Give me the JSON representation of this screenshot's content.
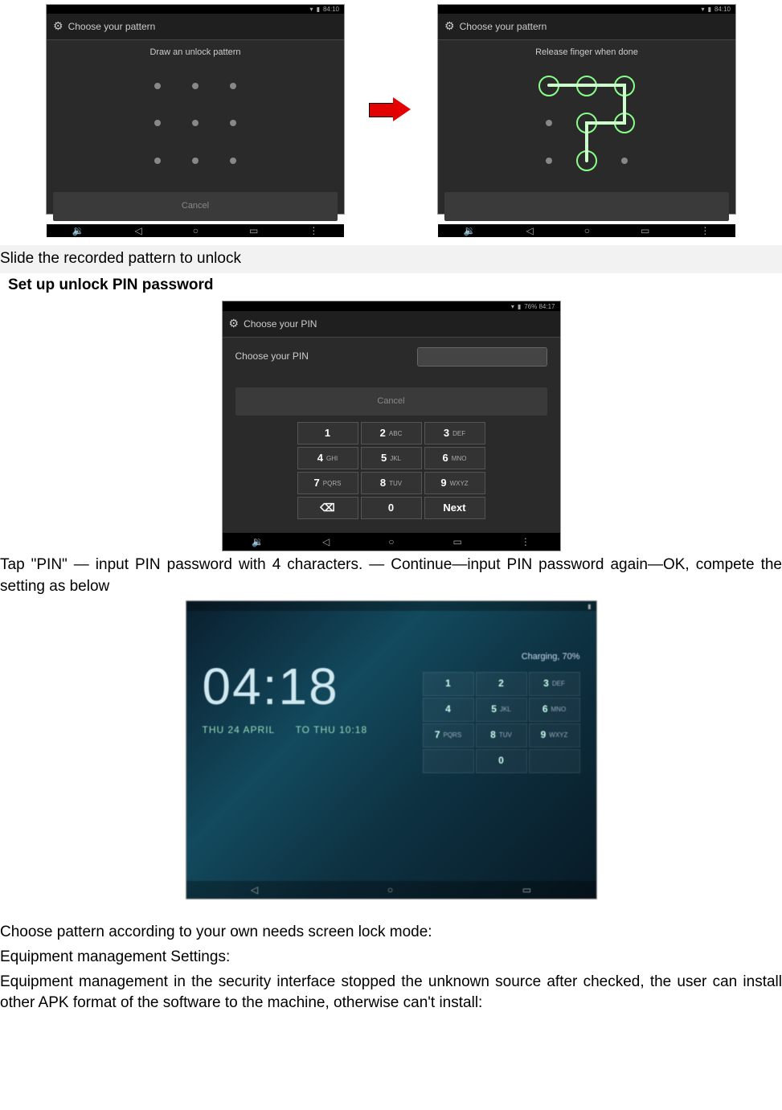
{
  "figures": {
    "pattern_left": {
      "title": "Choose your pattern",
      "instruction": "Draw an unlock pattern",
      "cancel": "Cancel",
      "status_time": "84:10"
    },
    "pattern_right": {
      "title": "Choose your pattern",
      "instruction": "Release finger when done",
      "status_time": "84:10"
    },
    "pin_setup": {
      "title": "Choose your PIN",
      "label": "Choose your PIN",
      "cancel": "Cancel",
      "status_time": "76% 84:17",
      "keys": [
        {
          "n": "1",
          "l": ""
        },
        {
          "n": "2",
          "l": "ABC"
        },
        {
          "n": "3",
          "l": "DEF"
        },
        {
          "n": "4",
          "l": "GHI"
        },
        {
          "n": "5",
          "l": "JKL"
        },
        {
          "n": "6",
          "l": "MNO"
        },
        {
          "n": "7",
          "l": "PQRS"
        },
        {
          "n": "8",
          "l": "TUV"
        },
        {
          "n": "9",
          "l": "WXYZ"
        },
        {
          "n": "⌫",
          "l": ""
        },
        {
          "n": "0",
          "l": ""
        },
        {
          "n": "Next",
          "l": ""
        }
      ]
    },
    "lock_screen": {
      "time": "04:18",
      "date_left": "THU 24 APRIL",
      "date_right": "TO THU 10:18",
      "charging": "Charging, 70%",
      "keys": [
        {
          "n": "1",
          "l": ""
        },
        {
          "n": "2",
          "l": ""
        },
        {
          "n": "3",
          "l": "DEF"
        },
        {
          "n": "4",
          "l": ""
        },
        {
          "n": "5",
          "l": "JKL"
        },
        {
          "n": "6",
          "l": "MNO"
        },
        {
          "n": "7",
          "l": "PQRS"
        },
        {
          "n": "8",
          "l": "TUV"
        },
        {
          "n": "9",
          "l": "WXYZ"
        },
        {
          "n": "",
          "l": ""
        },
        {
          "n": "0",
          "l": ""
        },
        {
          "n": "",
          "l": ""
        }
      ]
    }
  },
  "text": {
    "slide_line": "Slide the recorded pattern to unlock",
    "heading_pin": "Set up unlock PIN password",
    "tap_pin": "Tap \"PIN\" — input PIN password with 4 characters. — Continue—input PIN password again—OK, compete the setting as below",
    "choose_pattern": "Choose pattern according to your own needs screen lock mode:",
    "equip_settings": "Equipment management Settings:",
    "equip_desc": "Equipment management in the security interface stopped the unknown source after checked, the user can install other APK format of the software to the machine, otherwise can't install:"
  },
  "nav": {
    "back": "◁",
    "home": "○",
    "recent": "▭",
    "menu": "⋮",
    "vol": "🔉"
  }
}
